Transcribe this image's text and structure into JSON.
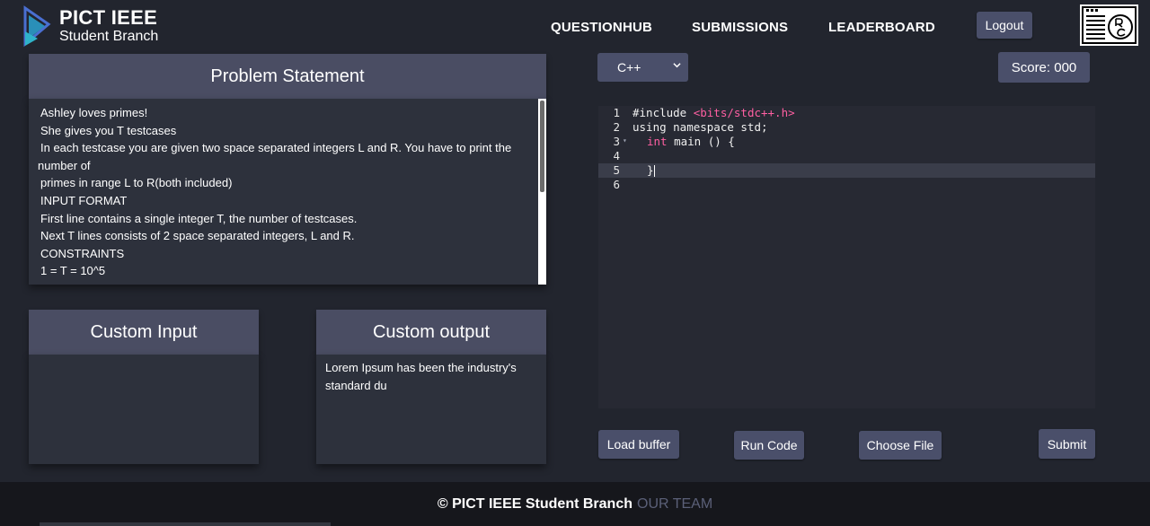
{
  "brand": {
    "title": "PICT IEEE",
    "subtitle": "Student Branch"
  },
  "nav": [
    {
      "label": "QUESTIONHUB"
    },
    {
      "label": "SUBMISSIONS"
    },
    {
      "label": "LEADERBOARD"
    }
  ],
  "logout_label": "Logout",
  "problem": {
    "heading": "Problem Statement",
    "lines": [
      "Ashley loves primes!",
      "She gives you T testcases",
      "In each testcase you are given two space separated integers L and R. You have to print the",
      "number of",
      "primes in range L to R(both included)",
      "INPUT FORMAT",
      "First line contains a single integer T, the number of testcases.",
      "Next T lines consists of 2 space separated integers, L and R.",
      "CONSTRAINTS",
      "1 = T = 10^5"
    ]
  },
  "custom_input": {
    "heading": "Custom Input",
    "value": ""
  },
  "custom_output": {
    "heading": "Custom output",
    "value": "Lorem Ipsum has been the industry's standard du"
  },
  "language": {
    "selected": "C++"
  },
  "score": "Score: 000",
  "editor": {
    "line_numbers": [
      "1",
      "2",
      "3",
      "4",
      "5",
      "6"
    ],
    "code": {
      "line1_a": "#include ",
      "line1_b": "<bits/stdc++.h>",
      "line2": "using namespace std;",
      "line3_kw": "int",
      "line3_rest": " main () {",
      "line5": "}"
    }
  },
  "actions": {
    "load_buffer": "Load buffer",
    "run_code": "Run Code",
    "choose_file": "Choose File",
    "submit": "Submit"
  },
  "footer": {
    "copyright": "© PICT IEEE Student Branch",
    "team": "OUR TEAM"
  },
  "colors": {
    "background": "#22252e",
    "panel": "#2d313c",
    "panel_header": "#4a4d63",
    "button": "#4a4f6a",
    "editor": "#272933",
    "accent_pink": "#ff5fa2"
  }
}
